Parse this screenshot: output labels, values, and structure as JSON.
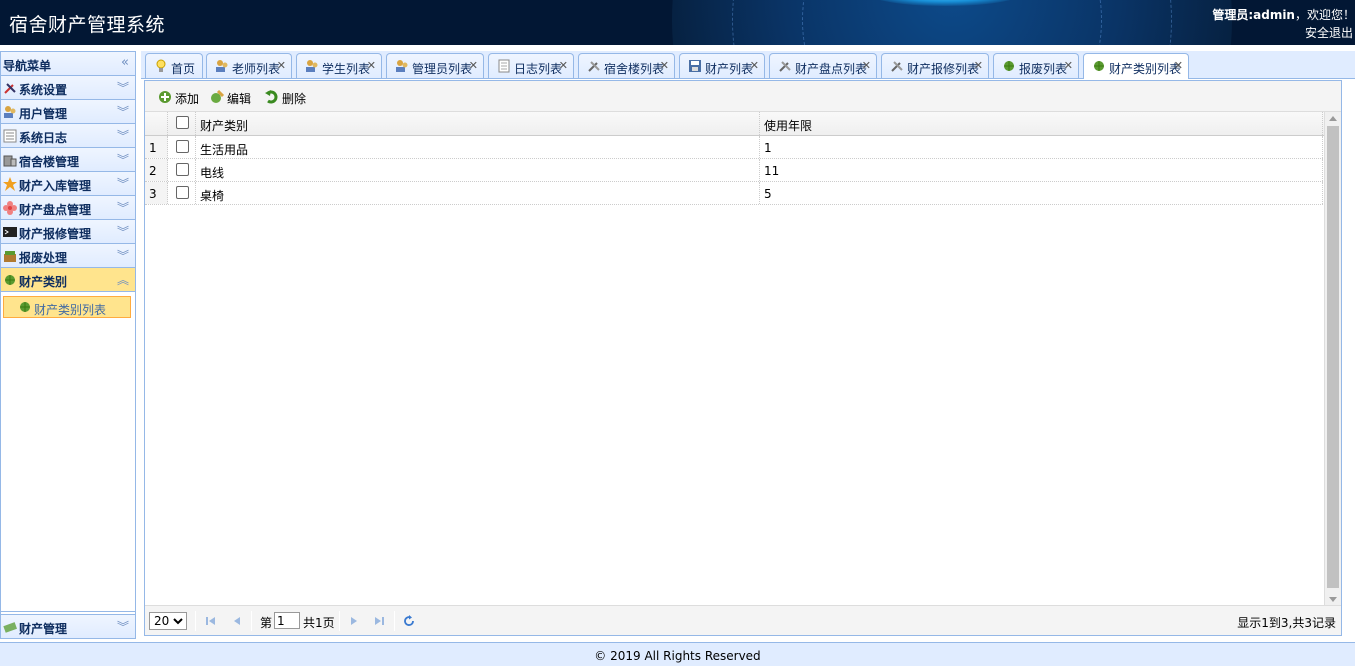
{
  "header": {
    "title": "宿舍财产管理系统",
    "welcome_prefix": "管理员:",
    "username": "admin",
    "welcome_suffix": "，欢迎您！",
    "logout": "安全退出"
  },
  "sidebar": {
    "title": "导航菜单",
    "items": [
      {
        "label": "系统设置",
        "icon": "tools-icon"
      },
      {
        "label": "用户管理",
        "icon": "users-icon"
      },
      {
        "label": "系统日志",
        "icon": "log-icon"
      },
      {
        "label": "宿舍楼管理",
        "icon": "building-icon"
      },
      {
        "label": "财产入库管理",
        "icon": "star-icon"
      },
      {
        "label": "财产盘点管理",
        "icon": "flower-icon"
      },
      {
        "label": "财产报修管理",
        "icon": "terminal-icon"
      },
      {
        "label": "报废处理",
        "icon": "basket-icon"
      },
      {
        "label": "财产类别",
        "icon": "leaf-icon"
      }
    ],
    "active_sub": "财产类别列表",
    "bottom_item": "财产管理"
  },
  "tabs": [
    {
      "label": "首页",
      "icon": "bulb-icon",
      "closable": false
    },
    {
      "label": "老师列表",
      "icon": "users-icon",
      "closable": true
    },
    {
      "label": "学生列表",
      "icon": "users-icon",
      "closable": true
    },
    {
      "label": "管理员列表",
      "icon": "users-icon",
      "closable": true
    },
    {
      "label": "日志列表",
      "icon": "document-icon",
      "closable": true
    },
    {
      "label": "宿舍楼列表",
      "icon": "tools-icon",
      "closable": true
    },
    {
      "label": "财产列表",
      "icon": "save-icon",
      "closable": true
    },
    {
      "label": "财产盘点列表",
      "icon": "tools-icon",
      "closable": true
    },
    {
      "label": "财产报修列表",
      "icon": "tools-icon",
      "closable": true
    },
    {
      "label": "报废列表",
      "icon": "leaf-icon",
      "closable": true
    },
    {
      "label": "财产类别列表",
      "icon": "leaf-icon",
      "closable": true
    }
  ],
  "toolbar": {
    "add": "添加",
    "edit": "编辑",
    "delete": "删除"
  },
  "grid": {
    "columns": [
      "财产类别",
      "使用年限"
    ],
    "rows": [
      {
        "num": "1",
        "category": "生活用品",
        "years": "1"
      },
      {
        "num": "2",
        "category": "电线",
        "years": "11"
      },
      {
        "num": "3",
        "category": "桌椅",
        "years": "5"
      }
    ]
  },
  "pager": {
    "page_size": "20",
    "page_prefix": "第",
    "page": "1",
    "page_suffix": "共1页",
    "info": "显示1到3,共3记录"
  },
  "footer": "© 2019 All Rights Reserved",
  "colors": {
    "header_bg": "#021734",
    "border": "#95b8e7",
    "active": "#ffe48d"
  }
}
